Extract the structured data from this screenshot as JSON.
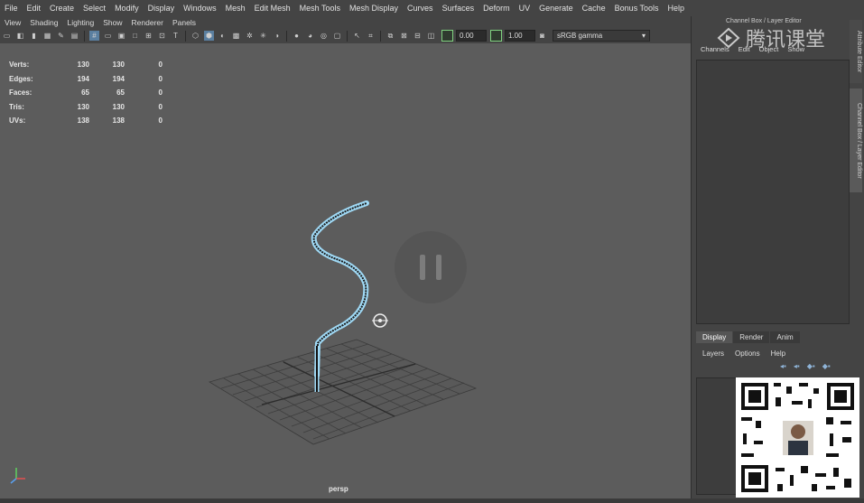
{
  "menubar": [
    "File",
    "Edit",
    "Create",
    "Select",
    "Modify",
    "Display",
    "Windows",
    "Mesh",
    "Edit Mesh",
    "Mesh Tools",
    "Mesh Display",
    "Curves",
    "Surfaces",
    "Deform",
    "UV",
    "Generate",
    "Cache",
    "Bonus Tools",
    "Help"
  ],
  "panel_menu": [
    "View",
    "Shading",
    "Lighting",
    "Show",
    "Renderer",
    "Panels"
  ],
  "toolbar": {
    "value1": "0.00",
    "value2": "1.00",
    "color_space": "sRGB gamma"
  },
  "hud": {
    "rows": [
      {
        "label": "Verts:",
        "a": "130",
        "b": "130",
        "c": "0"
      },
      {
        "label": "Edges:",
        "a": "194",
        "b": "194",
        "c": "0"
      },
      {
        "label": "Faces:",
        "a": "65",
        "b": "65",
        "c": "0"
      },
      {
        "label": "Tris:",
        "a": "130",
        "b": "130",
        "c": "0"
      },
      {
        "label": "UVs:",
        "a": "138",
        "b": "138",
        "c": "0"
      }
    ]
  },
  "viewport": {
    "camera_label": "persp"
  },
  "channel_box": {
    "title": "Channel Box / Layer Editor",
    "menu": [
      "Channels",
      "Edit",
      "Object",
      "Show"
    ],
    "side_tabs": [
      "Attribute Editor",
      "Channel Box / Layer Editor"
    ]
  },
  "layer_editor": {
    "tabs": [
      "Display",
      "Render",
      "Anim"
    ],
    "menu": [
      "Layers",
      "Options",
      "Help"
    ]
  },
  "watermark": {
    "text": "腾讯课堂"
  },
  "colors": {
    "accent": "#5a7fa0",
    "helix": "#8fd0f0"
  }
}
